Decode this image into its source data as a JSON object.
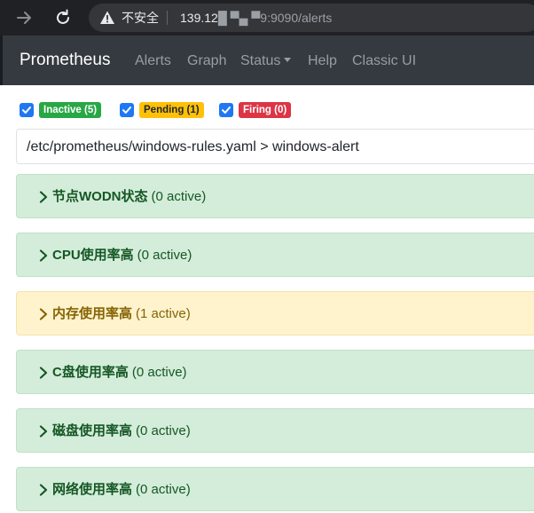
{
  "browser": {
    "security_label": "不安全",
    "url_host": "139.12",
    "url_masked": "█ ▀▄ ▀",
    "url_rest": "9:9090/alerts"
  },
  "navbar": {
    "brand": "Prometheus",
    "links": [
      "Alerts",
      "Graph",
      "Status",
      "Help",
      "Classic UI"
    ]
  },
  "filters": [
    {
      "label": "Inactive (5)",
      "checked": true,
      "color": "#28a745"
    },
    {
      "label": "Pending (1)",
      "checked": true,
      "color": "#ffc107"
    },
    {
      "label": "Firing (0)",
      "checked": true,
      "color": "#dc3545"
    }
  ],
  "group": {
    "title": "/etc/prometheus/windows-rules.yaml > windows-alert"
  },
  "rules": [
    {
      "name": "节点WODN状态",
      "count": "(0 active)",
      "state": "inactive"
    },
    {
      "name": "CPU使用率高",
      "count": "(0 active)",
      "state": "inactive"
    },
    {
      "name": "内存使用率高",
      "count": "(1 active)",
      "state": "pending"
    },
    {
      "name": "C盘使用率高",
      "count": "(0 active)",
      "state": "inactive"
    },
    {
      "name": "磁盘使用率高",
      "count": "(0 active)",
      "state": "inactive"
    },
    {
      "name": "网络使用率高",
      "count": "(0 active)",
      "state": "inactive"
    }
  ]
}
